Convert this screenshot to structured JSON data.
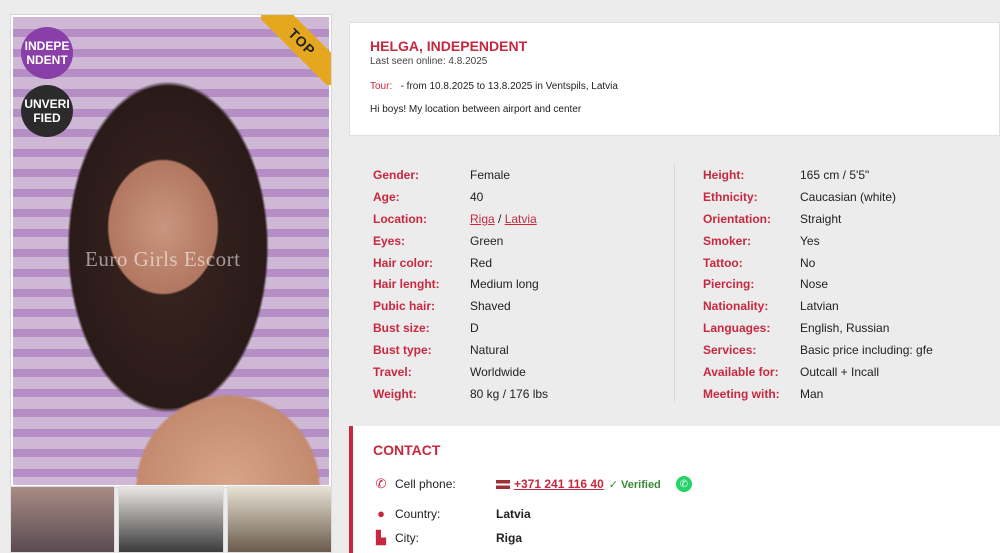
{
  "badges": {
    "independent": "INDEPENDENT",
    "unverified": "UNVERIFIED",
    "top": "TOP"
  },
  "watermark": "Euro Girls Escort",
  "profile": {
    "name": "HELGA, INDEPENDENT",
    "last_seen": "Last seen online: 4.8.2025",
    "tour_label": "Tour:",
    "tour_text": "- from 10.8.2025 to 13.8.2025 in Ventspils, Latvia",
    "about": "Hi boys! My location between airport and center"
  },
  "details_left": [
    {
      "label": "Gender:",
      "value": "Female"
    },
    {
      "label": "Age:",
      "value": "40"
    },
    {
      "label": "Location:",
      "value": ""
    },
    {
      "label": "Eyes:",
      "value": "Green"
    },
    {
      "label": "Hair color:",
      "value": "Red"
    },
    {
      "label": "Hair lenght:",
      "value": "Medium long"
    },
    {
      "label": "Pubic hair:",
      "value": "Shaved"
    },
    {
      "label": "Bust size:",
      "value": "D"
    },
    {
      "label": "Bust type:",
      "value": "Natural"
    },
    {
      "label": "Travel:",
      "value": "Worldwide"
    },
    {
      "label": "Weight:",
      "value": "80 kg / 176 lbs"
    }
  ],
  "location_links": {
    "city": "Riga",
    "sep": " / ",
    "country": "Latvia"
  },
  "details_right": [
    {
      "label": "Height:",
      "value": "165 cm / 5'5\""
    },
    {
      "label": "Ethnicity:",
      "value": "Caucasian (white)"
    },
    {
      "label": "Orientation:",
      "value": "Straight"
    },
    {
      "label": "Smoker:",
      "value": "Yes"
    },
    {
      "label": "Tattoo:",
      "value": "No"
    },
    {
      "label": "Piercing:",
      "value": "Nose"
    },
    {
      "label": "Nationality:",
      "value": "Latvian"
    },
    {
      "label": "Languages:",
      "value": "English, Russian"
    },
    {
      "label": "Services:",
      "value": "Basic price including: gfe"
    },
    {
      "label": "Available for:",
      "value": "Outcall + Incall"
    },
    {
      "label": "Meeting with:",
      "value": "Man"
    }
  ],
  "contact": {
    "title": "CONTACT",
    "phone_label": "Cell phone:",
    "phone": "+371 241 116 40",
    "verified": "✓ Verified",
    "country_label": "Country:",
    "country": "Latvia",
    "city_label": "City:",
    "city": "Riga"
  },
  "icons": {
    "phone": "phone-icon",
    "globe": "globe-icon",
    "city": "city-icon",
    "whatsapp": "whatsapp-icon",
    "flag": "latvia-flag-icon"
  }
}
